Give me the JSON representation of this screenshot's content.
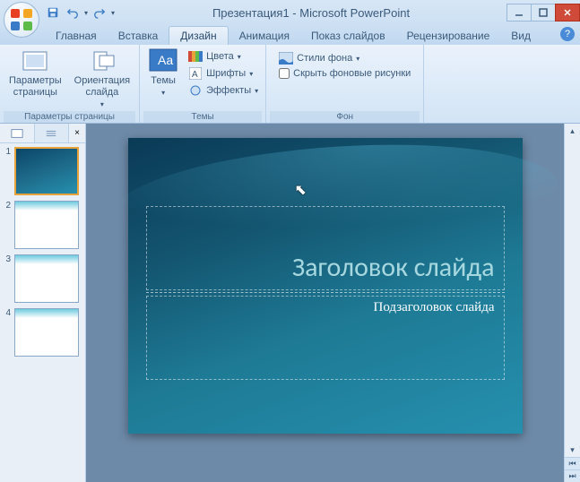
{
  "title": "Презентация1 - Microsoft PowerPoint",
  "tabs": {
    "home": "Главная",
    "insert": "Вставка",
    "design": "Дизайн",
    "animation": "Анимация",
    "slideshow": "Показ слайдов",
    "review": "Рецензирование",
    "view": "Вид"
  },
  "ribbon": {
    "page_setup_group": "Параметры страницы",
    "page_params": "Параметры\nстраницы",
    "orientation": "Ориентация\nслайда",
    "themes_group": "Темы",
    "themes": "Темы",
    "colors": "Цвета",
    "fonts": "Шрифты",
    "effects": "Эффекты",
    "background_group": "Фон",
    "bg_styles": "Стили фона",
    "hide_bg": "Скрыть фоновые рисунки"
  },
  "slides": [
    {
      "num": "1",
      "selected": true,
      "dark": true
    },
    {
      "num": "2",
      "selected": false,
      "dark": false
    },
    {
      "num": "3",
      "selected": false,
      "dark": false
    },
    {
      "num": "4",
      "selected": false,
      "dark": false
    }
  ],
  "slide_content": {
    "title_placeholder": "Заголовок слайда",
    "subtitle_placeholder": "Подзаголовок слайда"
  }
}
